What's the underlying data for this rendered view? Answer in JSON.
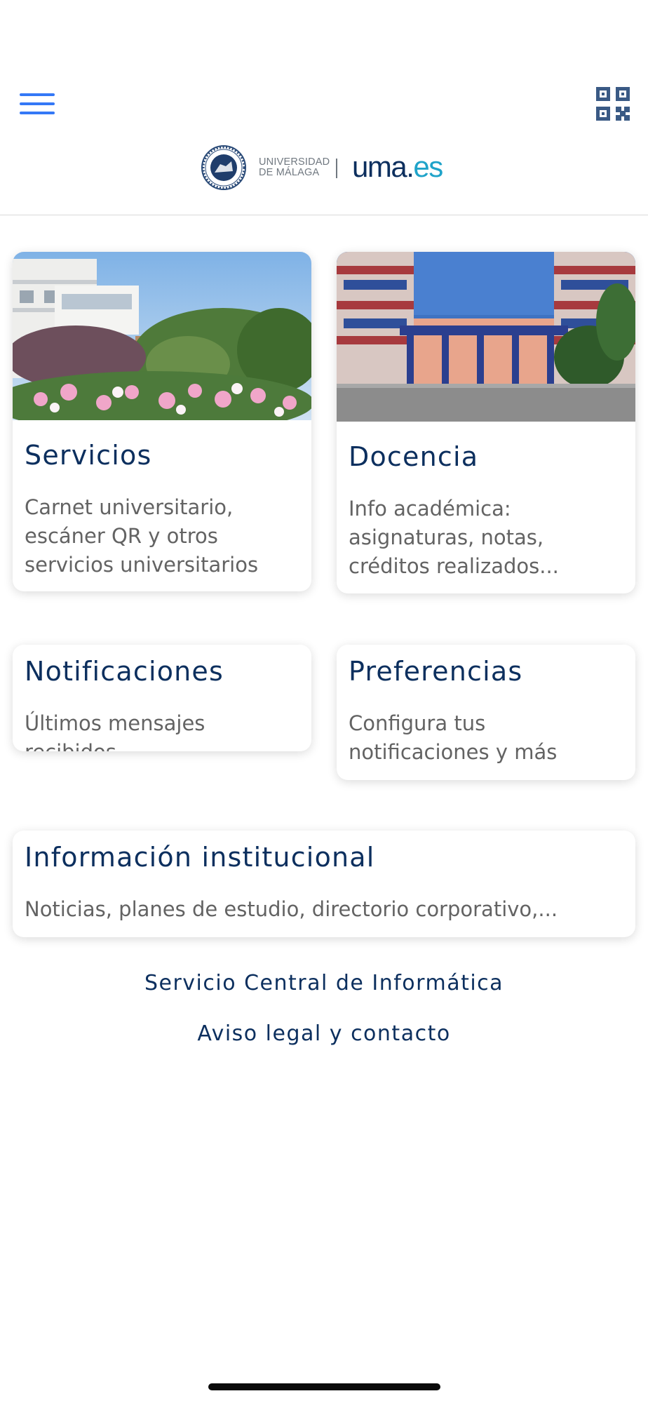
{
  "header": {
    "menu_icon": "hamburger-menu-icon",
    "qr_icon": "qr-code-icon",
    "logo": {
      "university_line1": "UNIVERSIDAD",
      "university_line2": "DE MÁLAGA",
      "domain_main": "uma",
      "domain_dot": ".",
      "domain_tld": "es"
    }
  },
  "cards": {
    "servicios": {
      "title": "Servicios",
      "description": "Carnet universitario, escáner QR y otros servicios universitarios"
    },
    "docencia": {
      "title": "Docencia",
      "description": "Info académica: asignaturas, notas, créditos realizados..."
    },
    "notificaciones": {
      "title": "Notificaciones",
      "description": "Últimos mensajes recibidos"
    },
    "preferencias": {
      "title": "Preferencias",
      "description": "Configura tus notificaciones y más"
    },
    "informacion": {
      "title": "Información institucional",
      "description": "Noticias, planes de estudio, directorio corporativo,..."
    }
  },
  "footer": {
    "link1": "Servicio Central de Informática",
    "link2": "Aviso legal y contacto"
  },
  "colors": {
    "accent_blue": "#3478f6",
    "title_navy": "#0c2f5e",
    "description_gray": "#636363",
    "uma_cyan": "#1fa3c9"
  }
}
